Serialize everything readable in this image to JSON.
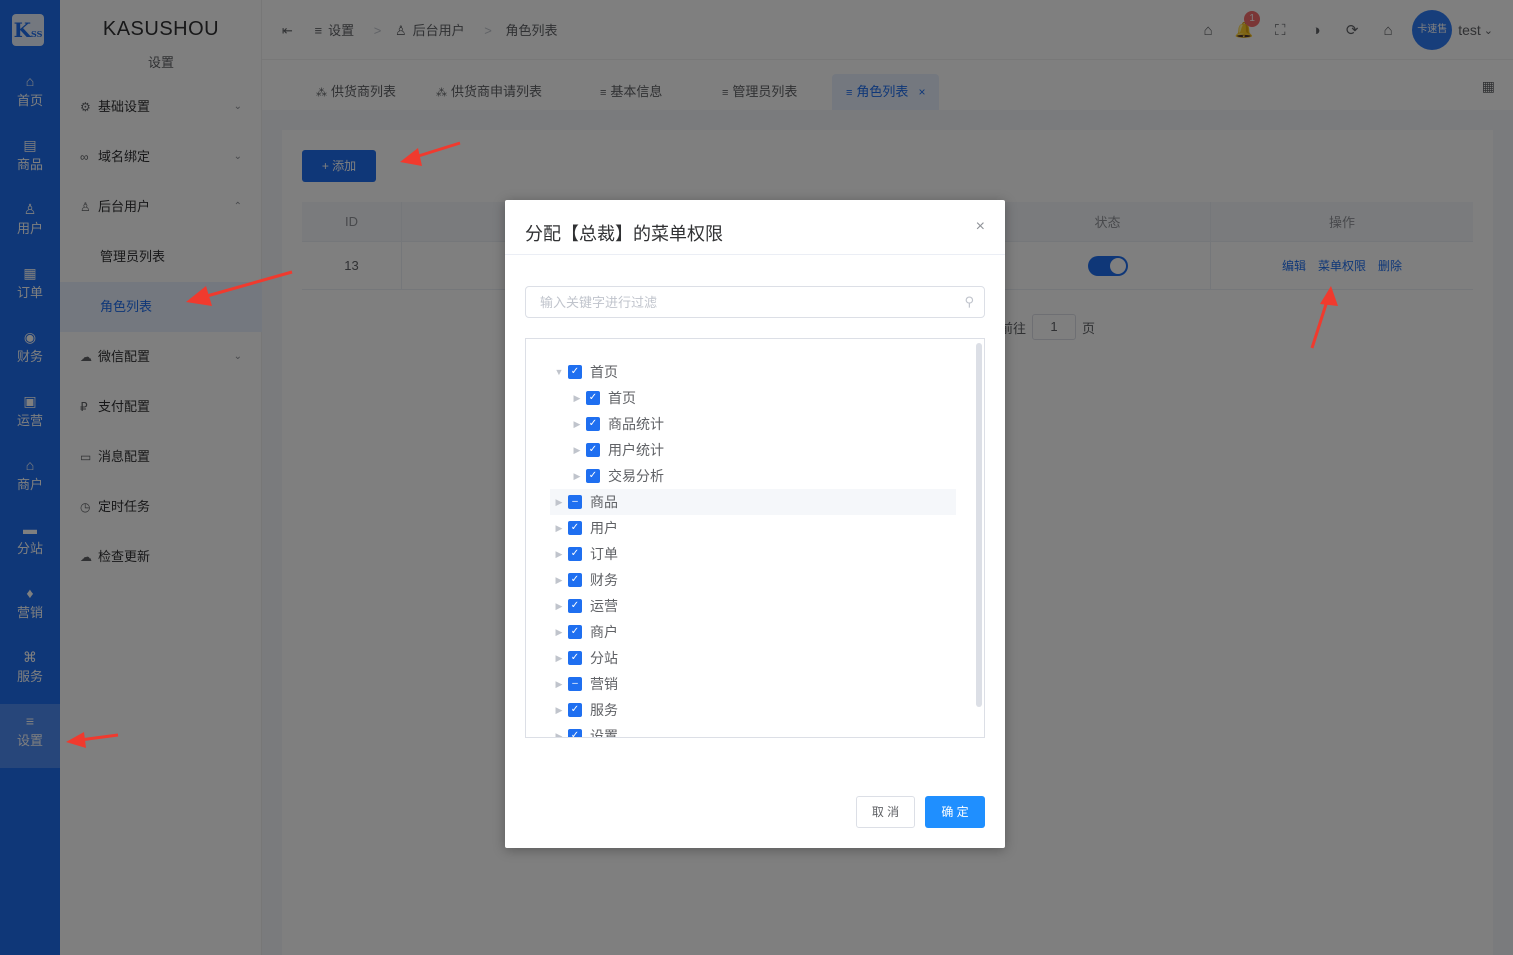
{
  "app": {
    "logo": "K",
    "logo_sub": "SS",
    "brand": "KASUSHOU",
    "brand_sub": "设置"
  },
  "nav": {
    "items": [
      {
        "label": "首页",
        "icon": "home-icon",
        "glyph": "⌂"
      },
      {
        "label": "商品",
        "icon": "goods-icon",
        "glyph": "▤"
      },
      {
        "label": "用户",
        "icon": "user-icon",
        "glyph": "♙"
      },
      {
        "label": "订单",
        "icon": "order-icon",
        "glyph": "▦"
      },
      {
        "label": "财务",
        "icon": "finance-icon",
        "glyph": "◉"
      },
      {
        "label": "运营",
        "icon": "operation-icon",
        "glyph": "▣"
      },
      {
        "label": "商户",
        "icon": "merchant-icon",
        "glyph": "⌂"
      },
      {
        "label": "分站",
        "icon": "substation-icon",
        "glyph": "▬"
      },
      {
        "label": "营销",
        "icon": "gift-icon",
        "glyph": "♦"
      },
      {
        "label": "服务",
        "icon": "service-icon",
        "glyph": "⌘"
      },
      {
        "label": "设置",
        "icon": "settings-icon",
        "glyph": "≡"
      }
    ],
    "active_index": 10
  },
  "sidebar": {
    "items": [
      {
        "label": "基础设置",
        "icon": "gear-icon",
        "glyph": "⚙",
        "arrow": "⌄"
      },
      {
        "label": "域名绑定",
        "icon": "link-icon",
        "glyph": "∞",
        "arrow": "⌄"
      },
      {
        "label": "后台用户",
        "icon": "user-icon",
        "glyph": "♙",
        "arrow": "⌃"
      },
      {
        "label": "管理员列表",
        "sub": true
      },
      {
        "label": "角色列表",
        "sub": true,
        "active": true
      },
      {
        "label": "微信配置",
        "icon": "wechat-icon",
        "glyph": "☁",
        "arrow": "⌄"
      },
      {
        "label": "支付配置",
        "icon": "pay-icon",
        "glyph": "₽"
      },
      {
        "label": "消息配置",
        "icon": "message-icon",
        "glyph": "▭"
      },
      {
        "label": "定时任务",
        "icon": "clock-icon",
        "glyph": "◷"
      },
      {
        "label": "检查更新",
        "icon": "cloud-icon",
        "glyph": "☁"
      }
    ]
  },
  "header": {
    "collapse_glyph": "⇤",
    "breadcrumb": [
      "设置",
      "后台用户",
      "角色列表"
    ],
    "breadcrumb_glyphs": [
      "≡",
      "♙"
    ],
    "sep": ">",
    "notification_count": "1",
    "avatar_text": "卡速售",
    "username": "test",
    "user_arrow": "⌄",
    "icons": [
      "⌂",
      "🔔",
      "⛶",
      "◑",
      "⟳",
      "⌂"
    ]
  },
  "tabs": {
    "items": [
      {
        "label": "供货商列表",
        "glyph": "⁂"
      },
      {
        "label": "供货商申请列表",
        "glyph": "⁂"
      },
      {
        "label": "基本信息",
        "glyph": "≡"
      },
      {
        "label": "管理员列表",
        "glyph": "≡"
      },
      {
        "label": "角色列表",
        "glyph": "≡",
        "active": true,
        "close": "×"
      }
    ],
    "grid_glyph": "▦"
  },
  "main": {
    "add_button": "+ 添加",
    "table": {
      "headers": [
        "ID",
        "状态",
        "操作"
      ],
      "rows": [
        {
          "id": "13",
          "actions": [
            "编辑",
            "菜单权限",
            "删除"
          ]
        }
      ]
    },
    "pager": {
      "prefix": "前往",
      "page": "1",
      "suffix": "页"
    }
  },
  "dialog": {
    "title": "分配【总裁】的菜单权限",
    "close": "×",
    "search_placeholder": "输入关键字进行过滤",
    "search_icon": "⚲",
    "tree": [
      {
        "label": "首页",
        "level": 0,
        "expanded": true,
        "state": "checked"
      },
      {
        "label": "首页",
        "level": 1,
        "state": "checked"
      },
      {
        "label": "商品统计",
        "level": 1,
        "state": "checked"
      },
      {
        "label": "用户统计",
        "level": 1,
        "state": "checked"
      },
      {
        "label": "交易分析",
        "level": 1,
        "state": "checked"
      },
      {
        "label": "商品",
        "level": 0,
        "state": "indeterminate",
        "highlight": true
      },
      {
        "label": "用户",
        "level": 0,
        "state": "checked"
      },
      {
        "label": "订单",
        "level": 0,
        "state": "checked"
      },
      {
        "label": "财务",
        "level": 0,
        "state": "checked"
      },
      {
        "label": "运营",
        "level": 0,
        "state": "checked"
      },
      {
        "label": "商户",
        "level": 0,
        "state": "checked"
      },
      {
        "label": "分站",
        "level": 0,
        "state": "checked"
      },
      {
        "label": "营销",
        "level": 0,
        "state": "indeterminate"
      },
      {
        "label": "服务",
        "level": 0,
        "state": "checked"
      },
      {
        "label": "设置",
        "level": 0,
        "state": "checked"
      }
    ],
    "cancel": "取 消",
    "ok": "确 定"
  },
  "colors": {
    "primary": "#1f6ff0",
    "annotation": "#f03a2e"
  }
}
